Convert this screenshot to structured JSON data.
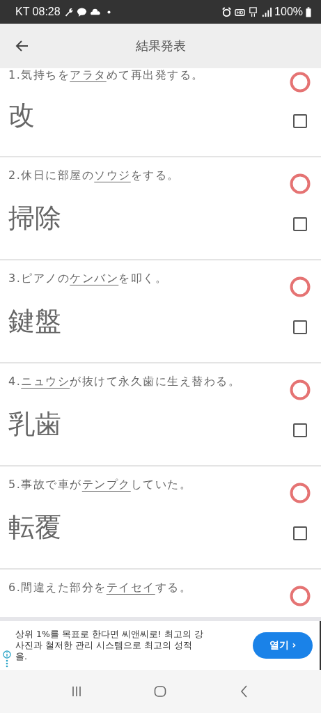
{
  "status_bar": {
    "carrier_time": "KT 08:28",
    "battery": "100%"
  },
  "app_bar": {
    "title": "結果発表"
  },
  "questions": [
    {
      "number": "1.",
      "before": "気持ちを",
      "underlined": "アラタ",
      "after": "めて再出発する。",
      "answer": "改",
      "correct": true,
      "checked": false
    },
    {
      "number": "2.",
      "before": "休日に部屋の",
      "underlined": "ソウジ",
      "after": "をする。",
      "answer": "掃除",
      "correct": true,
      "checked": false
    },
    {
      "number": "3.",
      "before": "ピアノの",
      "underlined": "ケンバン",
      "after": "を叩く。",
      "answer": "鍵盤",
      "correct": true,
      "checked": false
    },
    {
      "number": "4.",
      "underlined": "ニュウシ",
      "after": "が抜けて永久歯に生え替わる。",
      "answer": "乳歯",
      "correct": true,
      "checked": false
    },
    {
      "number": "5.",
      "before": "事故で車が",
      "underlined": "テンプク",
      "after": "していた。",
      "answer": "転覆",
      "correct": true,
      "checked": false
    },
    {
      "number": "6.",
      "before": "間違えた部分を",
      "underlined": "テイセイ",
      "after": "する。",
      "correct": true
    }
  ],
  "ad": {
    "text": "상위 1%를 목표로 한다면 씨앤씨로! 최고의 강사진과 철저한 관리 시스템으로 최고의 성적을.",
    "button": "열기 ›"
  }
}
